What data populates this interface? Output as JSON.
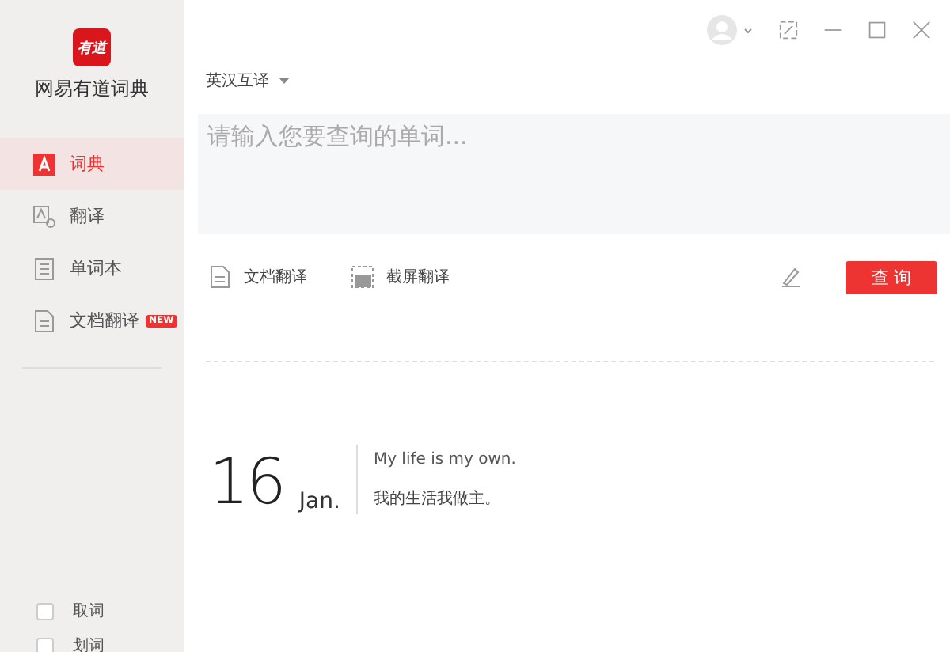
{
  "app": {
    "logo": "有道",
    "name": "网易有道词典"
  },
  "nav": [
    {
      "label": "词典",
      "kind": "dict",
      "selected": true
    },
    {
      "label": "翻译",
      "kind": "translate",
      "selected": false
    },
    {
      "label": "单词本",
      "kind": "wordbook",
      "selected": false
    },
    {
      "label": "文档翻译",
      "kind": "doc",
      "selected": false,
      "badge": "NEW"
    }
  ],
  "options": [
    {
      "label": "取词",
      "checked": false
    },
    {
      "label": "划词",
      "checked": false
    }
  ],
  "language": "英汉互译",
  "search": {
    "placeholder": "请输入您要查询的单词..."
  },
  "tools": [
    {
      "label": "文档翻译",
      "kind": "doc"
    },
    {
      "label": "截屏翻译",
      "kind": "camera"
    }
  ],
  "query_button": "查 询",
  "daily": {
    "day": "16",
    "month": "Jan.",
    "english": "My life is my own.",
    "chinese": "我的生活我做主。"
  }
}
